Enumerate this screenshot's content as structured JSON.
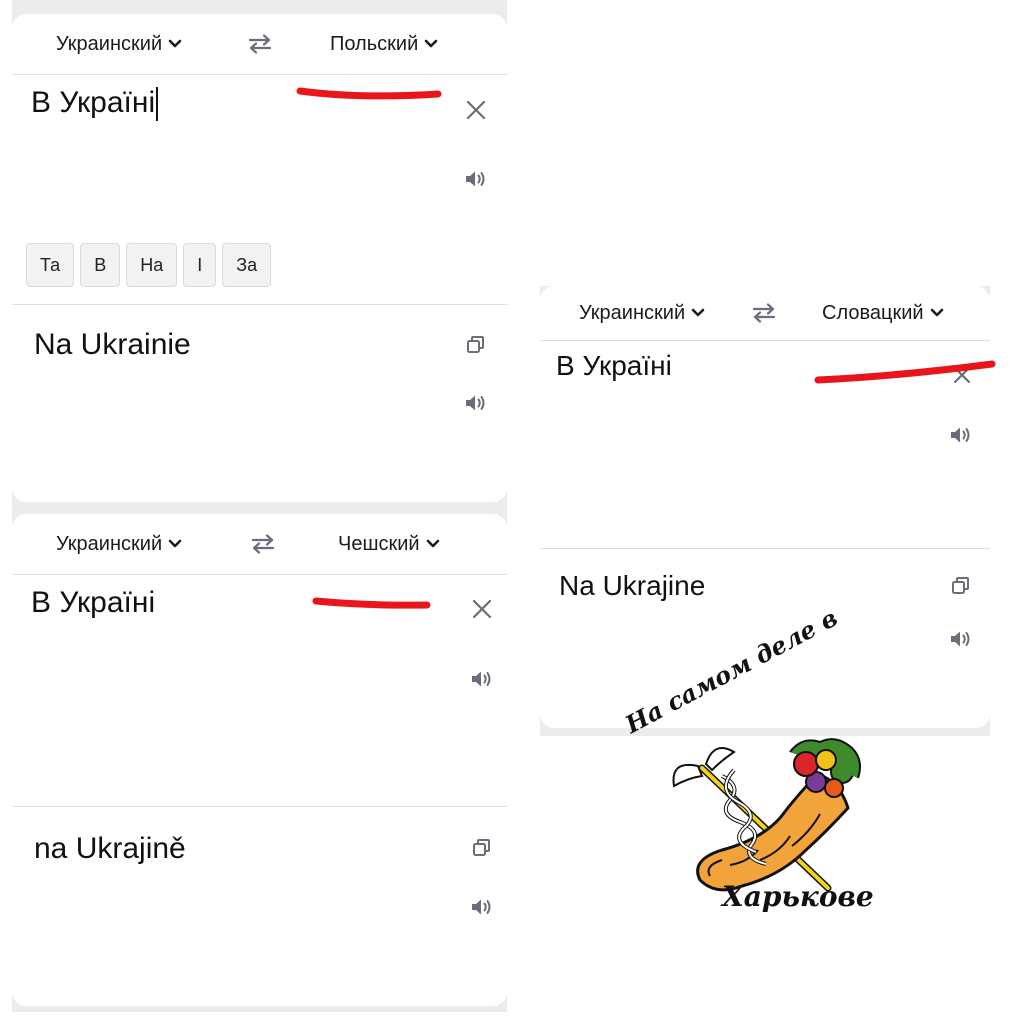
{
  "panels": {
    "polish": {
      "source_lang": "Украинский",
      "target_lang": "Польский",
      "source_text": "В Україні",
      "suggestions": [
        "Та",
        "В",
        "На",
        "І",
        "За"
      ],
      "translation": "Na Ukrainie"
    },
    "czech": {
      "source_lang": "Украинский",
      "target_lang": "Чешский",
      "source_text": "В Україні",
      "translation": "na Ukrajině"
    },
    "slovak": {
      "source_lang": "Украинский",
      "target_lang": "Словацкий",
      "source_text": "В Україні",
      "translation": "Na Ukrajine"
    }
  },
  "icons": {
    "chevron": "chevron-down-icon",
    "swap": "swap-arrows-icon",
    "clear": "close-icon",
    "speaker": "speaker-icon",
    "copy": "copy-icon"
  },
  "logo": {
    "top_line": "На самом деле в",
    "bottom_line": "Харькове"
  },
  "colors": {
    "panel_background": "#ffffff",
    "frame_gray": "#ececef",
    "divider": "#dedfe3",
    "icon_gray": "#6b6e78",
    "annotation_red": "#e8161b",
    "horn_orange": "#f2a33a"
  }
}
